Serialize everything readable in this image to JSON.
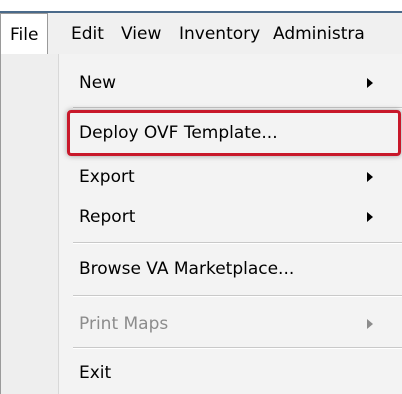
{
  "menubar": {
    "items": [
      {
        "label": "File"
      },
      {
        "label": "Edit"
      },
      {
        "label": "View"
      },
      {
        "label": "Inventory"
      },
      {
        "label": "Administra"
      }
    ]
  },
  "file_menu": {
    "items": [
      {
        "label": "New",
        "submenu": true,
        "enabled": true
      },
      {
        "label": "Deploy OVF Template...",
        "submenu": false,
        "enabled": true,
        "highlighted": true
      },
      {
        "label": "Export",
        "submenu": true,
        "enabled": true
      },
      {
        "label": "Report",
        "submenu": true,
        "enabled": true
      },
      {
        "label": "Browse VA Marketplace...",
        "submenu": false,
        "enabled": true
      },
      {
        "label": "Print Maps",
        "submenu": true,
        "enabled": false
      },
      {
        "label": "Exit",
        "submenu": false,
        "enabled": true
      }
    ]
  },
  "colors": {
    "highlight_border": "#c8182a",
    "menu_background": "#f3f3f3",
    "disabled_text": "#8c8c8c"
  }
}
